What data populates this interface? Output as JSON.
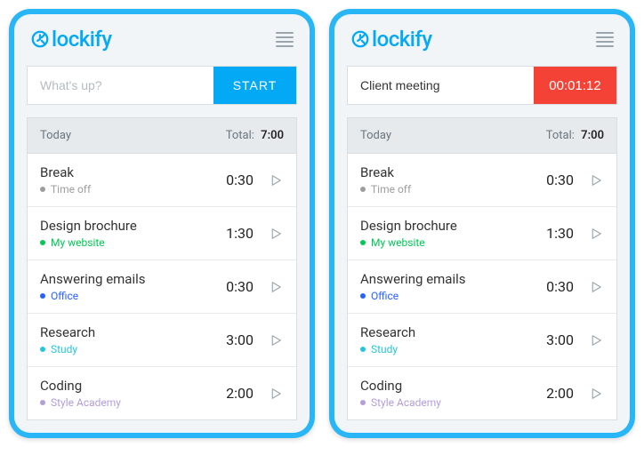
{
  "brand": "lockify",
  "left": {
    "input_placeholder": "What's up?",
    "input_value": "",
    "start_label": "START"
  },
  "right": {
    "input_value": "Client meeting",
    "timer": "00:01:12"
  },
  "today": {
    "label": "Today",
    "total_label": "Total:",
    "total_value": "7:00",
    "entries": [
      {
        "title": "Break",
        "project": "Time off",
        "color": "#9e9e9e",
        "duration": "0:30"
      },
      {
        "title": "Design brochure",
        "project": "My website",
        "color": "#00c853",
        "duration": "1:30"
      },
      {
        "title": "Answering emails",
        "project": "Office",
        "color": "#2962ff",
        "duration": "0:30"
      },
      {
        "title": "Research",
        "project": "Study",
        "color": "#26c6da",
        "duration": "3:00"
      },
      {
        "title": "Coding",
        "project": "Style Academy",
        "color": "#b39ddb",
        "duration": "2:00"
      }
    ]
  }
}
